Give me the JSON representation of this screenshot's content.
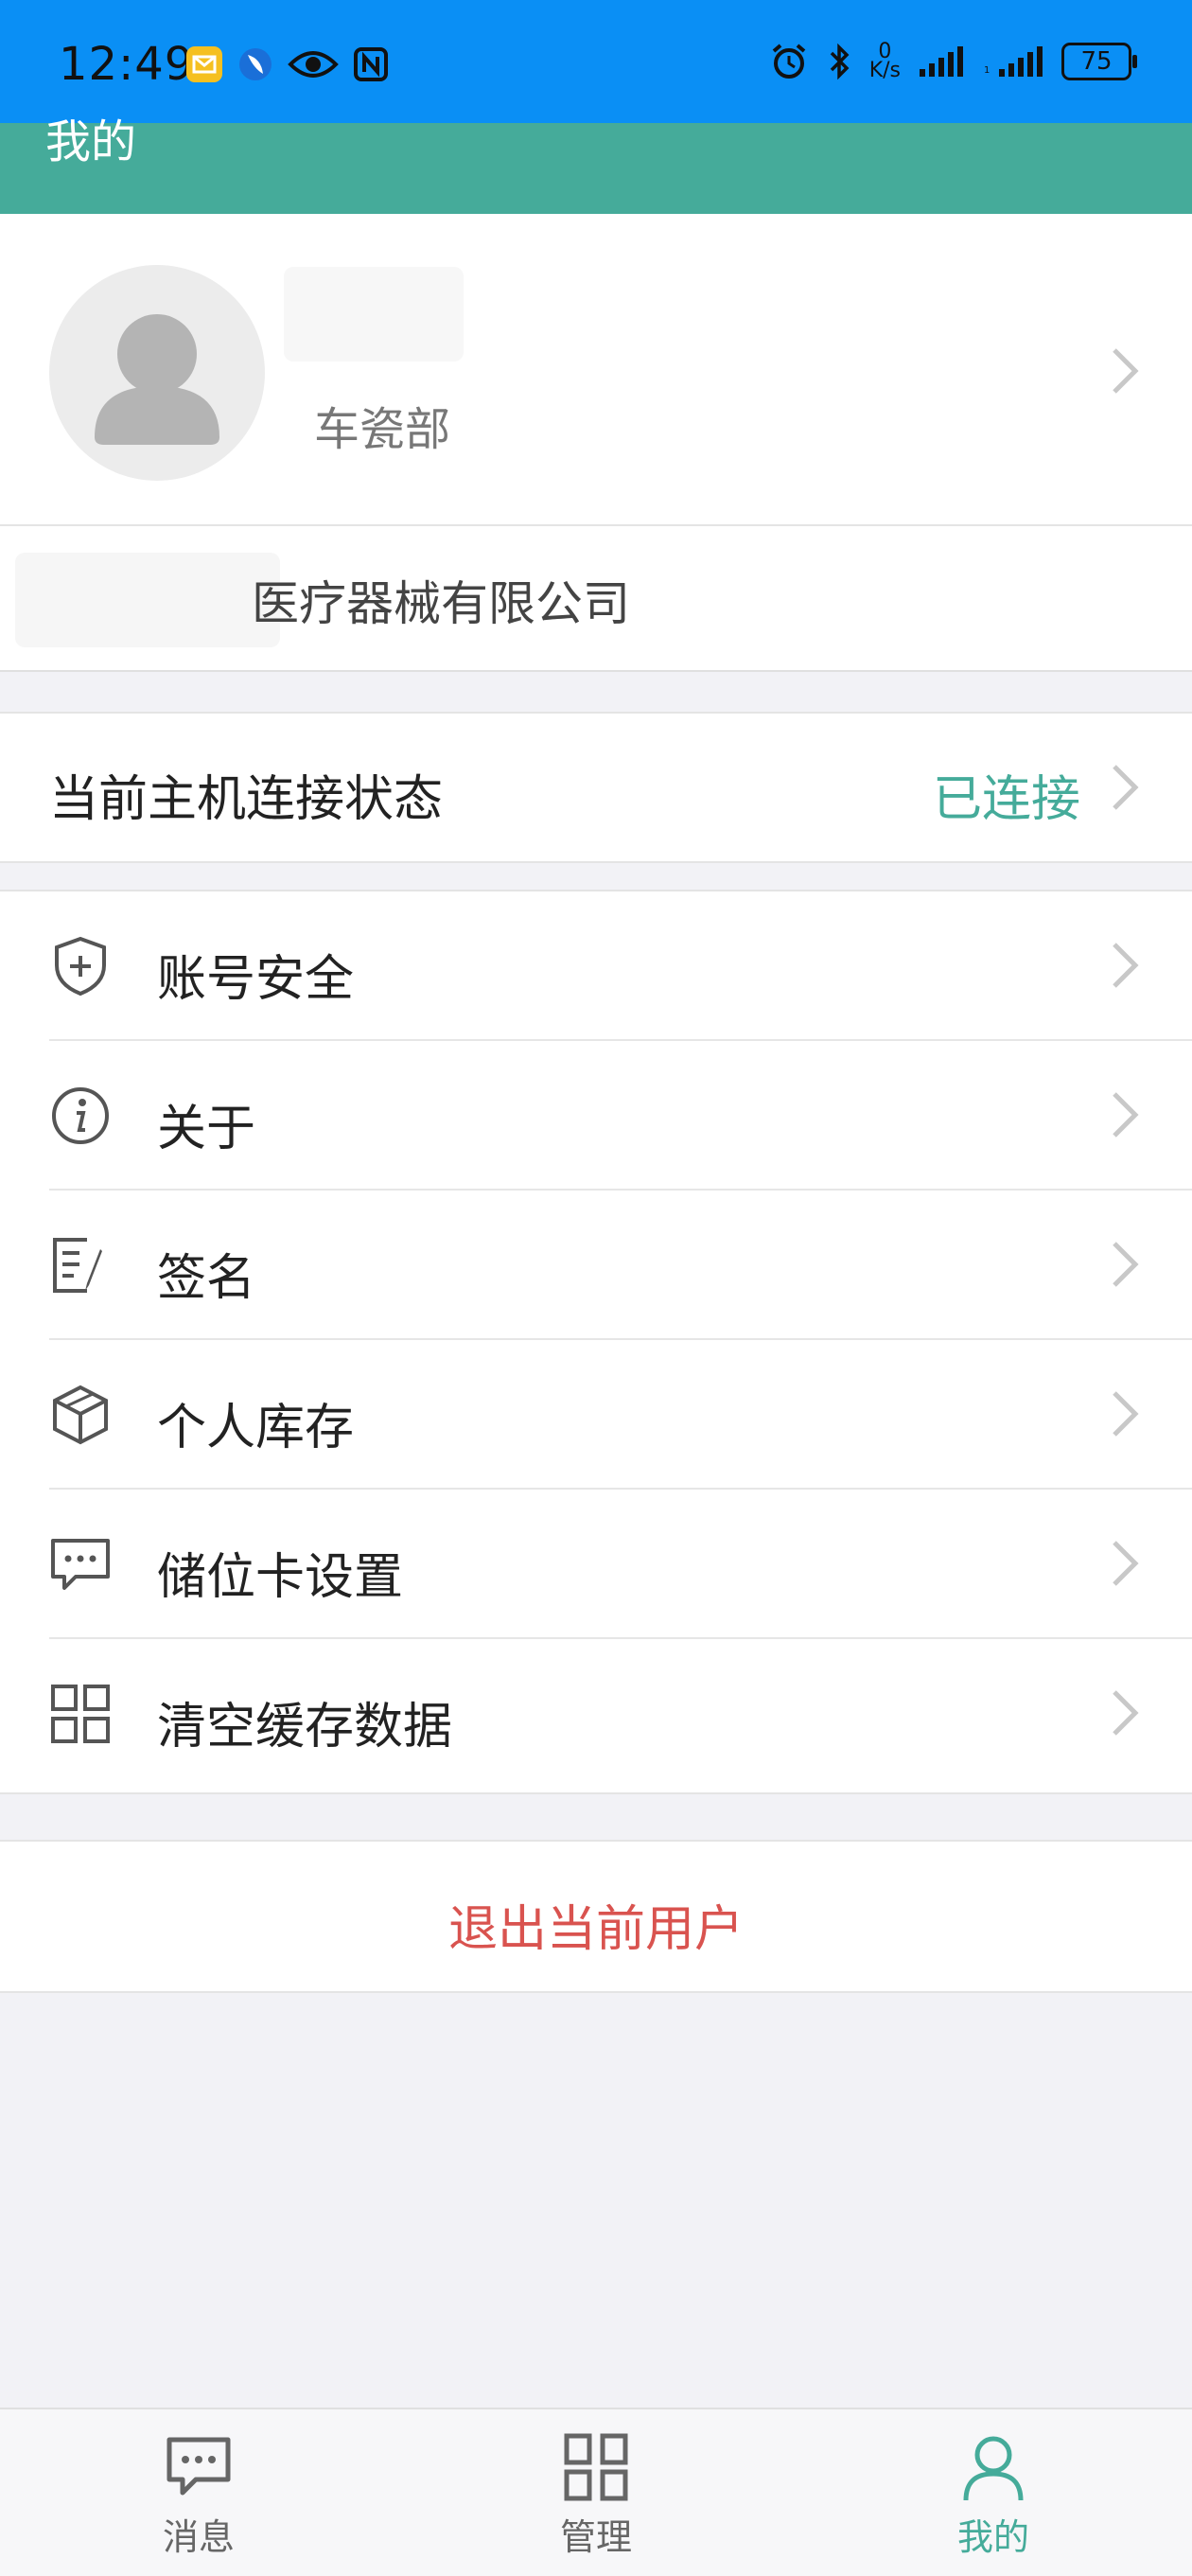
{
  "status_bar": {
    "time": "12:49",
    "net_speed_value": "0",
    "net_speed_unit": "K/s",
    "battery": "75"
  },
  "header": {
    "title": "我的"
  },
  "profile": {
    "department": "车瓷部"
  },
  "company": {
    "name": "医疗器械有限公司"
  },
  "connection": {
    "label": "当前主机连接状态",
    "status": "已连接"
  },
  "menu": {
    "items": [
      {
        "label": "账号安全",
        "icon": "shield-plus-icon"
      },
      {
        "label": "关于",
        "icon": "info-icon"
      },
      {
        "label": "签名",
        "icon": "signature-icon"
      },
      {
        "label": "个人库存",
        "icon": "box-icon"
      },
      {
        "label": "储位卡设置",
        "icon": "chat-dots-icon"
      },
      {
        "label": "清空缓存数据",
        "icon": "grid-icon"
      }
    ]
  },
  "logout": {
    "label": "退出当前用户"
  },
  "tabbar": {
    "tabs": [
      {
        "label": "消息",
        "icon": "message-icon"
      },
      {
        "label": "管理",
        "icon": "grid-icon"
      },
      {
        "label": "我的",
        "icon": "user-icon",
        "active": true
      }
    ]
  },
  "colors": {
    "status_bar": "#0a8ff5",
    "header": "#45ab9a",
    "accent": "#45ab9a",
    "danger": "#d9534f"
  }
}
